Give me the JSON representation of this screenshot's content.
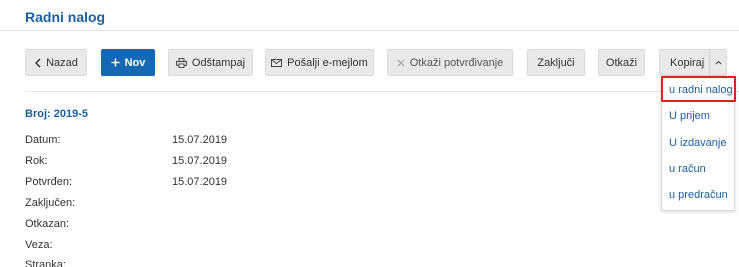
{
  "page": {
    "title": "Radni nalog"
  },
  "toolbar": {
    "back": {
      "label": "Nazad",
      "icon": "chevron-left-icon"
    },
    "new": {
      "label": "Nov",
      "icon": "plus-icon"
    },
    "print": {
      "label": "Odštampaj",
      "icon": "printer-icon"
    },
    "email": {
      "label": "Pošalji e-mejlom",
      "icon": "envelope-icon"
    },
    "unconfirm": {
      "label": "Otkaži potvrđivanje",
      "icon": "close-icon"
    },
    "lock": {
      "label": "Zaključi"
    },
    "cancel": {
      "label": "Otkaži"
    },
    "copy": {
      "label": "Kopiraj",
      "icon": "chevron-up-icon"
    }
  },
  "copy_menu": {
    "items": [
      {
        "label": "u radni nalog",
        "highlighted": true
      },
      {
        "label": "U prijem"
      },
      {
        "label": "U izdavanje"
      },
      {
        "label": "u račun"
      },
      {
        "label": "u predračun"
      }
    ]
  },
  "document": {
    "number": "Broj: 2019-5",
    "fields": [
      {
        "label": "Datum:",
        "value": "15.07.2019"
      },
      {
        "label": "Rok:",
        "value": "15.07.2019"
      },
      {
        "label": "Potvrđen:",
        "value": "15.07.2019"
      },
      {
        "label": "Zaključen:",
        "value": ""
      },
      {
        "label": "Otkazan:",
        "value": ""
      },
      {
        "label": "Veza:",
        "value": ""
      },
      {
        "label": "Stranka:",
        "value": ""
      }
    ]
  },
  "colors": {
    "accent": "#1467b3",
    "link": "#1a5fa0",
    "highlight": "#e02020"
  }
}
